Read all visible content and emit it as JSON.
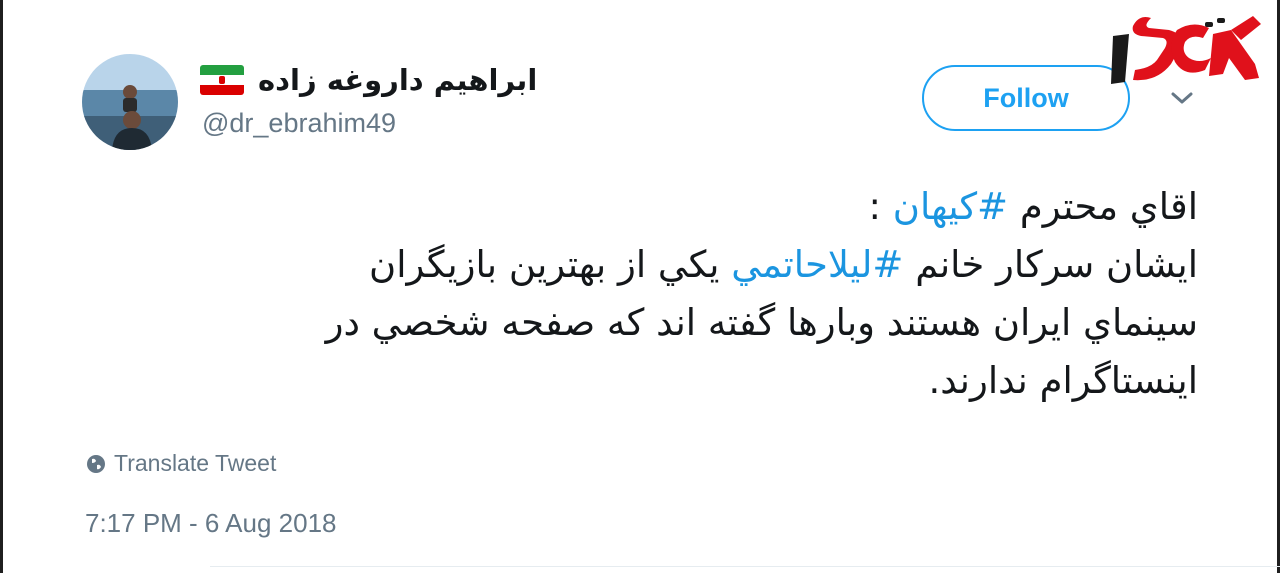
{
  "tweet": {
    "user": {
      "display_name": "ابراهيم داروغه زاده",
      "handle": "@dr_ebrahim49",
      "flag": "iran-flag"
    },
    "follow_label": "Follow",
    "text": {
      "line1_before": "اقاي محترم ",
      "hashtag1": "#كيهان",
      "line1_after": " :",
      "line2_before": "ايشان سركار خانم ",
      "hashtag2": "#ليلاحاتمي",
      "line2_after": " يكي از بهترين بازيگران",
      "line3": "سينماي ايران هستند وبارها گفته اند كه صفحه شخصي در",
      "line4": "اينستاگرام ندارند."
    },
    "translate_label": "Translate Tweet",
    "timestamp": "7:17 PM - 6 Aug 2018"
  },
  "colors": {
    "accent": "#1da1f2",
    "hashtag": "#1b95e0",
    "text": "#14171a",
    "muted": "#657786",
    "logo_red": "#e0111b",
    "logo_dark": "#1a1a1a"
  }
}
